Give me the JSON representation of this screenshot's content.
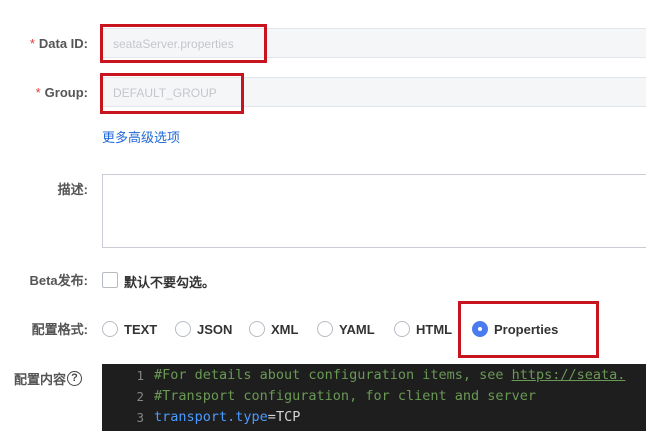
{
  "form": {
    "data_id": {
      "required_mark": "*",
      "label": "Data ID:",
      "value": "seataServer.properties"
    },
    "group": {
      "required_mark": "*",
      "label": "Group:",
      "value": "DEFAULT_GROUP"
    },
    "advanced_link": "更多高级选项",
    "description": {
      "label": "描述:",
      "value": ""
    },
    "beta": {
      "label": "Beta发布:",
      "checkbox_text": "默认不要勾选。",
      "checked": false
    },
    "format": {
      "label": "配置格式:",
      "options": [
        "TEXT",
        "JSON",
        "XML",
        "YAML",
        "HTML",
        "Properties"
      ],
      "selected": "Properties"
    },
    "content": {
      "label": "配置内容",
      "help_icon_text": "?",
      "lines": [
        {
          "num": "1",
          "comment": "#For details about configuration items, see ",
          "url": "https://seata."
        },
        {
          "num": "2",
          "comment": "#Transport configuration, for client and server"
        },
        {
          "num": "3",
          "key": "transport.type",
          "op": "=",
          "value": "TCP"
        }
      ]
    }
  },
  "colors": {
    "required": "#e4393c",
    "link": "#1f68d6",
    "highlight_frame": "#c8141e",
    "radio_selected": "#4a7cf0",
    "editor_bg": "#1e1e1e"
  },
  "icons": {
    "help": "question-circle-icon",
    "radio_selected": "radio-dot-icon"
  }
}
